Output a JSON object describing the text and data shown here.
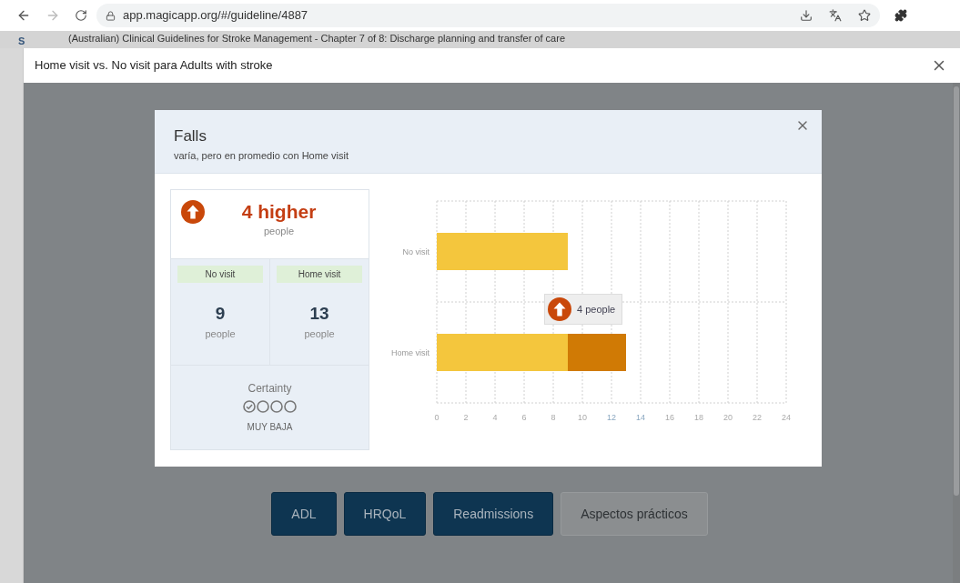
{
  "browser": {
    "url": "app.magicapp.org/#/guideline/4887"
  },
  "page": {
    "side_letter": "S",
    "guideline_title": "(Australian) Clinical Guidelines for Stroke Management - Chapter 7 of 8: Discharge planning and transfer of care"
  },
  "modal": {
    "title": "Home visit vs. No visit para Adults with stroke"
  },
  "dialog": {
    "title": "Falls",
    "subtitle": "varía, pero en promedio con Home visit",
    "summary": {
      "effect": "4 higher",
      "unit": "people",
      "groups": [
        {
          "label": "No visit",
          "value": "9",
          "unit": "people"
        },
        {
          "label": "Home visit",
          "value": "13",
          "unit": "people"
        }
      ],
      "certainty": {
        "label": "Certainty",
        "circles": [
          {
            "checked": true
          },
          {
            "checked": false
          },
          {
            "checked": false
          },
          {
            "checked": false
          }
        ],
        "rating": "MUY BAJA"
      }
    },
    "tooltip": {
      "text": "4 people"
    },
    "chart_data": {
      "type": "bar",
      "orientation": "horizontal",
      "stacked": true,
      "categories": [
        "No visit",
        "Home visit"
      ],
      "series": [
        {
          "color": "#f4c63d",
          "values": [
            9,
            9
          ]
        },
        {
          "color": "#d07a05",
          "values": [
            0,
            4
          ]
        }
      ],
      "grid": true,
      "xlim": [
        0,
        24
      ],
      "xticks": [
        0,
        2,
        4,
        6,
        8,
        10,
        12,
        14,
        16,
        18,
        20,
        22,
        24
      ]
    }
  },
  "outcome_buttons": [
    {
      "label": "ADL",
      "kind": "primary"
    },
    {
      "label": "HRQoL",
      "kind": "primary"
    },
    {
      "label": "Readmissions",
      "kind": "primary"
    },
    {
      "label": "Aspectos prácticos",
      "kind": "secondary"
    }
  ]
}
